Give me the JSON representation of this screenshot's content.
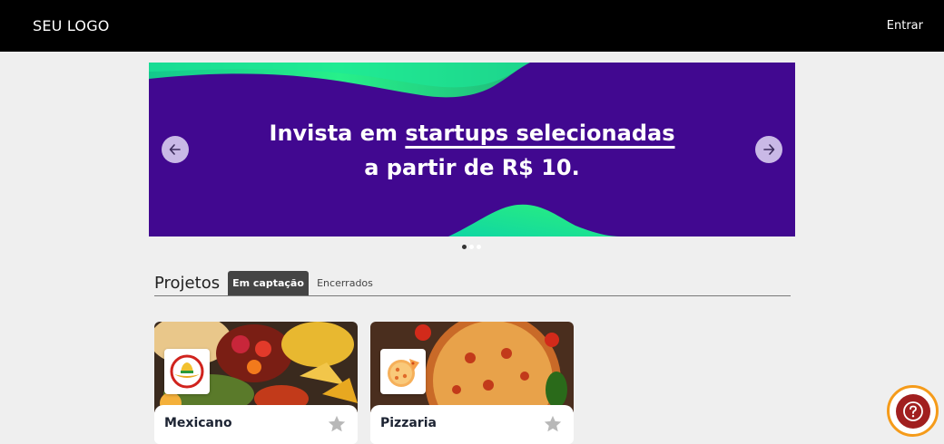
{
  "header": {
    "logo": "SEU LOGO",
    "login_label": "Entrar"
  },
  "banner": {
    "headline_prefix": "Invista em ",
    "headline_highlight": "startups selecionadas",
    "headline_line2": "a partir de R$ 10.",
    "prev_icon": "arrow-left-icon",
    "next_icon": "arrow-right-icon",
    "slide_count": 3,
    "active_slide": 1,
    "colors": {
      "background": "#410890",
      "accent": "#1de38a"
    }
  },
  "projects": {
    "title": "Projetos",
    "tabs": [
      {
        "label": "Em captação",
        "active": true
      },
      {
        "label": "Encerrados",
        "active": false
      }
    ],
    "cards": [
      {
        "name": "Mexicano",
        "favorite_icon": "star-icon"
      },
      {
        "name": "Pizzaria",
        "favorite_icon": "star-icon"
      }
    ]
  },
  "help_button": {
    "icon": "question-icon",
    "colors": {
      "ring": "#f59b1a",
      "fill": "#a11f1f"
    }
  }
}
